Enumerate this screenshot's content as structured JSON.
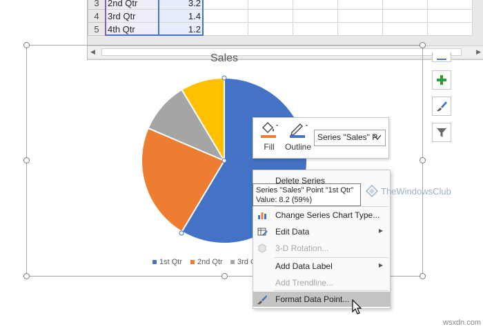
{
  "sheet": {
    "rows": [
      {
        "num": "3",
        "label": "2nd Qtr",
        "value": "3.2"
      },
      {
        "num": "4",
        "label": "3rd Qtr",
        "value": "1.4"
      },
      {
        "num": "5",
        "label": "4th Qtr",
        "value": "1.2"
      }
    ]
  },
  "chart": {
    "title": "Sales",
    "legend": [
      "1st Qtr",
      "2nd Qtr",
      "3rd Q"
    ]
  },
  "chart_data": {
    "type": "pie",
    "title": "Sales",
    "categories": [
      "1st Qtr",
      "2nd Qtr",
      "3rd Qtr",
      "4th Qtr"
    ],
    "values": [
      8.2,
      3.2,
      1.4,
      1.2
    ],
    "colors": [
      "#4472c4",
      "#ed7d31",
      "#a5a5a5",
      "#ffc000"
    ],
    "legend": "bottom"
  },
  "side_buttons": [
    "plus-icon",
    "brush-icon",
    "filter-icon"
  ],
  "minibar": {
    "fill_label": "Fill",
    "outline_label": "Outline",
    "series_value": "Series \"Sales\" P"
  },
  "menu": {
    "items": [
      {
        "label": "Delete Series",
        "disabled": false,
        "submenu": false
      },
      {
        "label": "Change Series Chart Type...",
        "disabled": false,
        "submenu": false
      },
      {
        "label": "Edit Data",
        "disabled": false,
        "submenu": true
      },
      {
        "label": "3-D Rotation...",
        "disabled": true,
        "submenu": false
      },
      {
        "label": "Add Data Label",
        "disabled": false,
        "submenu": true
      },
      {
        "label": "Add Trendline...",
        "disabled": true,
        "submenu": false
      },
      {
        "label": "Format Data Point...",
        "disabled": false,
        "submenu": false,
        "hover": true
      }
    ]
  },
  "tooltip": {
    "line1": "Series \"Sales\" Point \"1st Qtr\"",
    "line2": "Value: 8.2 (59%)"
  },
  "watermarks": {
    "brand": "TheWindowsClub",
    "site": "wsxdn.com"
  }
}
